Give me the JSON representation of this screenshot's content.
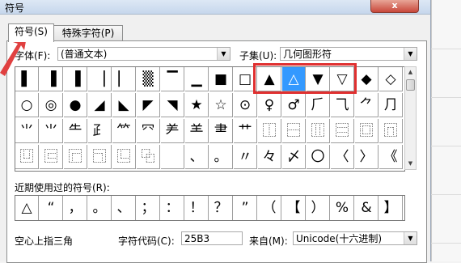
{
  "window": {
    "title": "符号",
    "close_label": "x"
  },
  "tabs": [
    {
      "label": "符号(S)"
    },
    {
      "label": "特殊字符(P)"
    }
  ],
  "font": {
    "label": "字体(F):",
    "value": "(普通文本)"
  },
  "subset": {
    "label": "子集(U):",
    "value": "几何图形符"
  },
  "symbols": [
    "▌",
    "▐",
    "▐",
    "▕",
    "▏",
    "▒",
    "▔",
    "▁",
    "■",
    "□",
    "▲",
    "△",
    "▼",
    "▽",
    "◆",
    "◇",
    "○",
    "◎",
    "●",
    "◢",
    "◣",
    "◤",
    "◥",
    "★",
    "☆",
    "⊙",
    "♀",
    "♂",
    "⺁",
    "⺄",
    "⺈",
    "⺆",
    "⺌",
    "⺌",
    "⺧",
    "⺪",
    "⺮",
    "⺳",
    "⺶",
    "⺷",
    "⺻",
    "⺾",
    "⿰",
    "⿱",
    "⿲",
    "⿳",
    "⿴",
    "⿵",
    "⿶",
    "⿷",
    "⿸",
    "⿹",
    "⿺",
    "⿻",
    "",
    "、",
    "。",
    "〃",
    "々",
    "〆",
    "〇",
    "〈",
    "〉",
    "《"
  ],
  "selected_index": 11,
  "recent": {
    "label": "近期使用过的符号(R):",
    "items": [
      "△",
      "“",
      "，",
      "。",
      "、",
      "；",
      "：",
      "！",
      "？",
      "”",
      "（",
      "【",
      "）",
      "%",
      "&",
      "】"
    ]
  },
  "char_name": "空心上指三角",
  "char_code": {
    "label": "字符代码(C):",
    "value": "25B3"
  },
  "from": {
    "label": "来自(M):",
    "value": "Unicode(十六进制)"
  },
  "colors": {
    "selected": "#3399ff",
    "highlight": "#e03030",
    "pointer": "#e04040"
  }
}
